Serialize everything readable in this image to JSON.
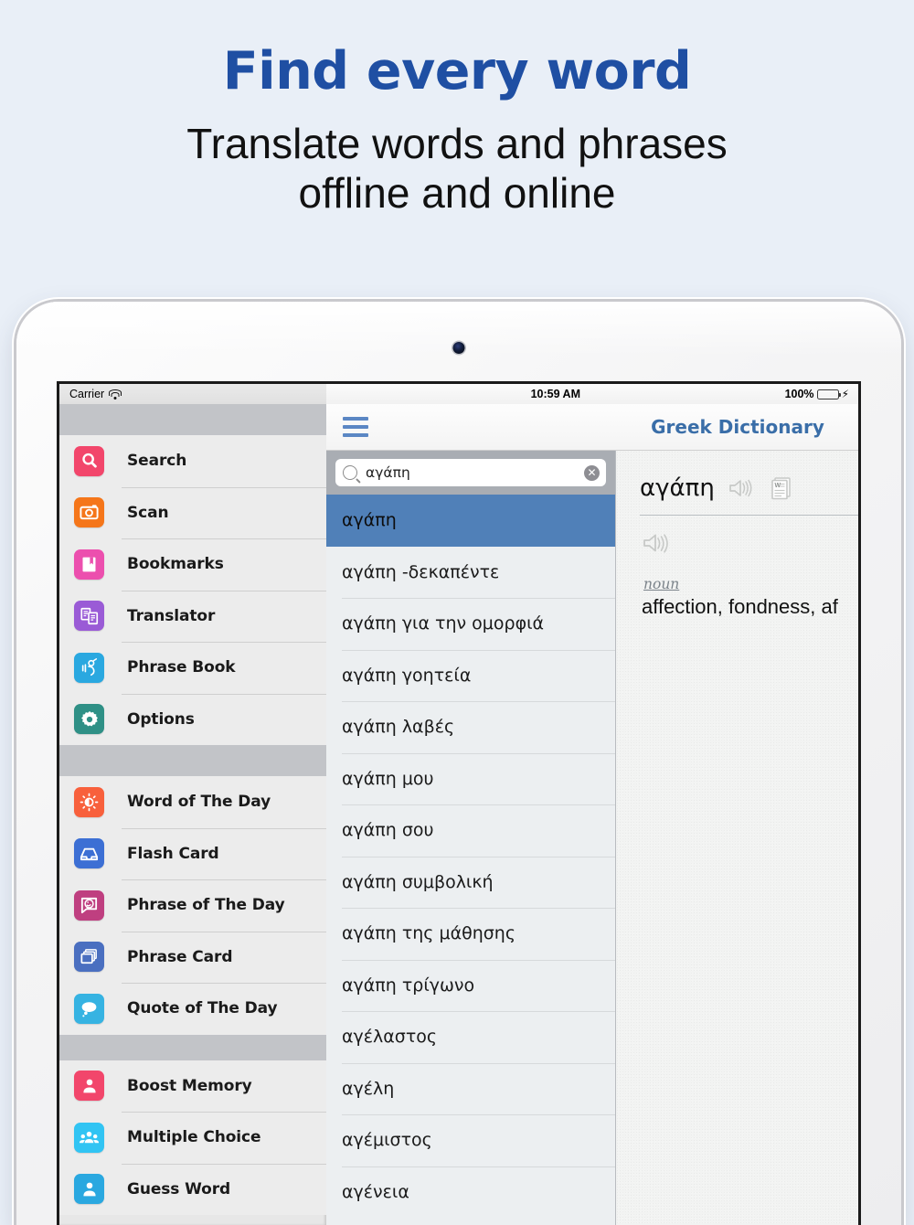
{
  "promo": {
    "headline": "Find every word",
    "subtitle_line1": "Translate words and phrases",
    "subtitle_line2": "offline and online",
    "headline_color": "#1f4fa3",
    "background_color": "#e9eff7"
  },
  "status_bar": {
    "carrier": "Carrier",
    "wifi_icon": "wifi-icon",
    "time": "10:59 AM",
    "battery_percent": "100%",
    "battery_icon": "battery-full-icon",
    "charging_icon": "lightning-bolt-icon"
  },
  "navbar": {
    "menu_icon": "hamburger-menu-icon",
    "title": "Greek Dictionary",
    "title_color": "#3a6ea8"
  },
  "sidebar": {
    "groups": [
      {
        "items": [
          {
            "label": "Search",
            "icon": "magnifier-icon",
            "color": "#f2466b"
          },
          {
            "label": "Scan",
            "icon": "camera-icon",
            "color": "#f5761a"
          },
          {
            "label": "Bookmarks",
            "icon": "bookmark-icon",
            "color": "#ec4fae"
          },
          {
            "label": "Translator",
            "icon": "documents-icon",
            "color": "#9a5bd6"
          },
          {
            "label": "Phrase Book",
            "icon": "speaking-head-icon",
            "color": "#2aa8e0"
          },
          {
            "label": "Options",
            "icon": "gear-icon",
            "color": "#2f9086"
          }
        ]
      },
      {
        "items": [
          {
            "label": "Word of The Day",
            "icon": "sun-icon",
            "color": "#f8603c"
          },
          {
            "label": "Flash Card",
            "icon": "inbox-tray-icon",
            "color": "#3c6fd4"
          },
          {
            "label": "Phrase of The Day",
            "icon": "speech-smiley-icon",
            "color": "#bf3f80"
          },
          {
            "label": "Phrase Card",
            "icon": "card-stack-icon",
            "color": "#4a6fc0"
          },
          {
            "label": "Quote of The Day",
            "icon": "thought-bubble-icon",
            "color": "#36b3e2"
          }
        ]
      },
      {
        "items": [
          {
            "label": "Boost Memory",
            "icon": "person-icon",
            "color": "#f2466b"
          },
          {
            "label": "Multiple Choice",
            "icon": "people-group-icon",
            "color": "#31c4f3"
          },
          {
            "label": "Guess Word",
            "icon": "person-icon",
            "color": "#2aa8e0"
          }
        ]
      }
    ]
  },
  "search": {
    "value": "αγάπη",
    "placeholder": "Search",
    "search_icon": "magnifier-icon",
    "clear_icon": "clear-circle-icon"
  },
  "word_list": {
    "selected_index": 0,
    "selected_color": "#5080b8",
    "items": [
      "αγάπη",
      "αγάπη -δεκαπέντε",
      "αγάπη για την ομορφιά",
      "αγάπη γοητεία",
      "αγάπη λαβές",
      "αγάπη μου",
      "αγάπη σου",
      "αγάπη συμβολική",
      "αγάπη της μάθησης",
      "αγάπη τρίγωνο",
      "αγέλαστος",
      "αγέλη",
      "αγέμιστος",
      "αγένεια"
    ]
  },
  "detail": {
    "word": "αγάπη",
    "speak_icon": "speaker-icon",
    "article_icon": "word-document-icon",
    "pronounce_icon": "speaker-icon",
    "part_of_speech": "noun",
    "definition": "affection, fondness, af"
  }
}
